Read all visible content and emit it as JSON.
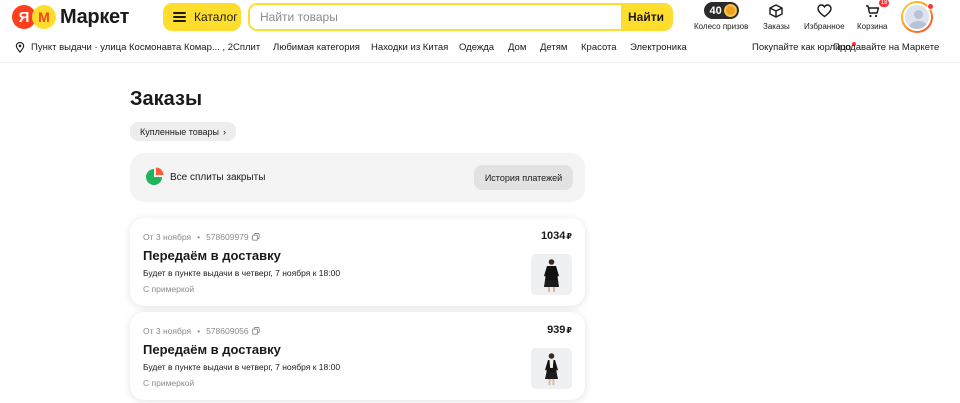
{
  "header": {
    "logo": {
      "ya": "Я",
      "m": "М",
      "text": "Маркет"
    },
    "catalog_label": "Каталог",
    "search": {
      "placeholder": "Найти товары",
      "button": "Найти"
    },
    "wheel": {
      "count": "40",
      "label": "Колесо призов"
    },
    "orders_label": "Заказы",
    "favorites_label": "Избранное",
    "cart": {
      "label": "Корзина",
      "badge": "18"
    }
  },
  "nav": {
    "pickup": "Пункт выдачи · улица Космонавта Комар... , 2",
    "links": [
      "Сплит",
      "Любимая категория",
      "Находки из Китая",
      "Одежда",
      "Дом",
      "Детям",
      "Красота",
      "Электроника"
    ],
    "business": "Покупайте как юрлицо",
    "sell": "Продавайте на Маркете"
  },
  "main": {
    "title": "Заказы",
    "chip": "Купленные товары",
    "splits": {
      "text": "Все сплиты закрыты",
      "history_button": "История платежей"
    },
    "orders": [
      {
        "date": "От 3 ноября",
        "number": "578609979",
        "price": "1034",
        "currency": "₽",
        "status": "Передаём в доставку",
        "delivery": "Будет в пункте выдачи в четверг, 7 ноября к 18:00",
        "option": "С примеркой"
      },
      {
        "date": "От 3 ноября",
        "number": "578609056",
        "price": "939",
        "currency": "₽",
        "status": "Передаём в доставку",
        "delivery": "Будет в пункте выдачи в четверг, 7 ноября к 18:00",
        "option": "С примеркой"
      }
    ]
  },
  "colors": {
    "brand_yellow": "#ffdd2d",
    "brand_red": "#fc3f1d",
    "split_green": "#1fb35a"
  }
}
